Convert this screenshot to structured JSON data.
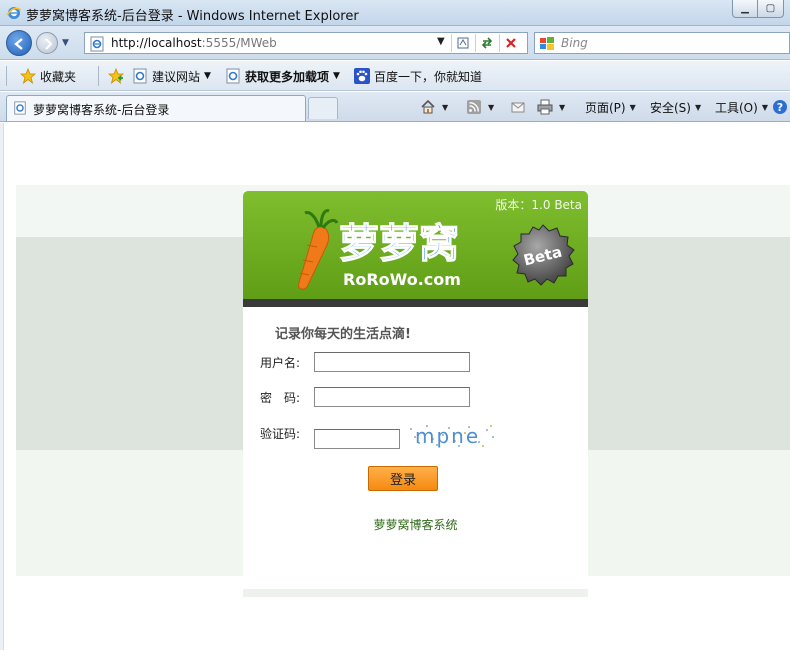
{
  "window": {
    "title": "萝萝窝博客系统-后台登录 - Windows Internet Explorer"
  },
  "address_bar": {
    "url_host": "http://localhost",
    "url_rest": ":5555/MWeb"
  },
  "search_box": {
    "placeholder": "Bing"
  },
  "favorites_bar": {
    "favorites_label": "收藏夹",
    "items": [
      {
        "label": "建议网站",
        "icon": "suggested-sites-icon"
      },
      {
        "label": "获取更多加载项",
        "icon": "addons-icon"
      },
      {
        "label": "百度一下，你就知道",
        "icon": "baidu-paw-icon"
      }
    ]
  },
  "tabs": [
    {
      "label": "萝萝窝博客系统-后台登录",
      "active": true
    }
  ],
  "command_bar": {
    "page_label": "页面(P)",
    "safety_label": "安全(S)",
    "tools_label": "工具(O)"
  },
  "login": {
    "version": "版本：1.0 Beta",
    "logo_text": "萝萝窝",
    "logo_domain": "RoRoWo.com",
    "beta_badge": "Beta",
    "slogan": "记录你每天的生活点滴!",
    "username_label": "用户名:",
    "password_label": "密　码:",
    "captcha_label": "验证码:",
    "username_value": "",
    "password_value": "",
    "captcha_value": "",
    "captcha_text": "mpne",
    "submit_label": "登录",
    "footer_text": "萝萝窝博客系统"
  },
  "colors": {
    "header_green": "#6aab1f",
    "button_orange": "#f7941d",
    "footer_green": "#2f6b1a"
  }
}
